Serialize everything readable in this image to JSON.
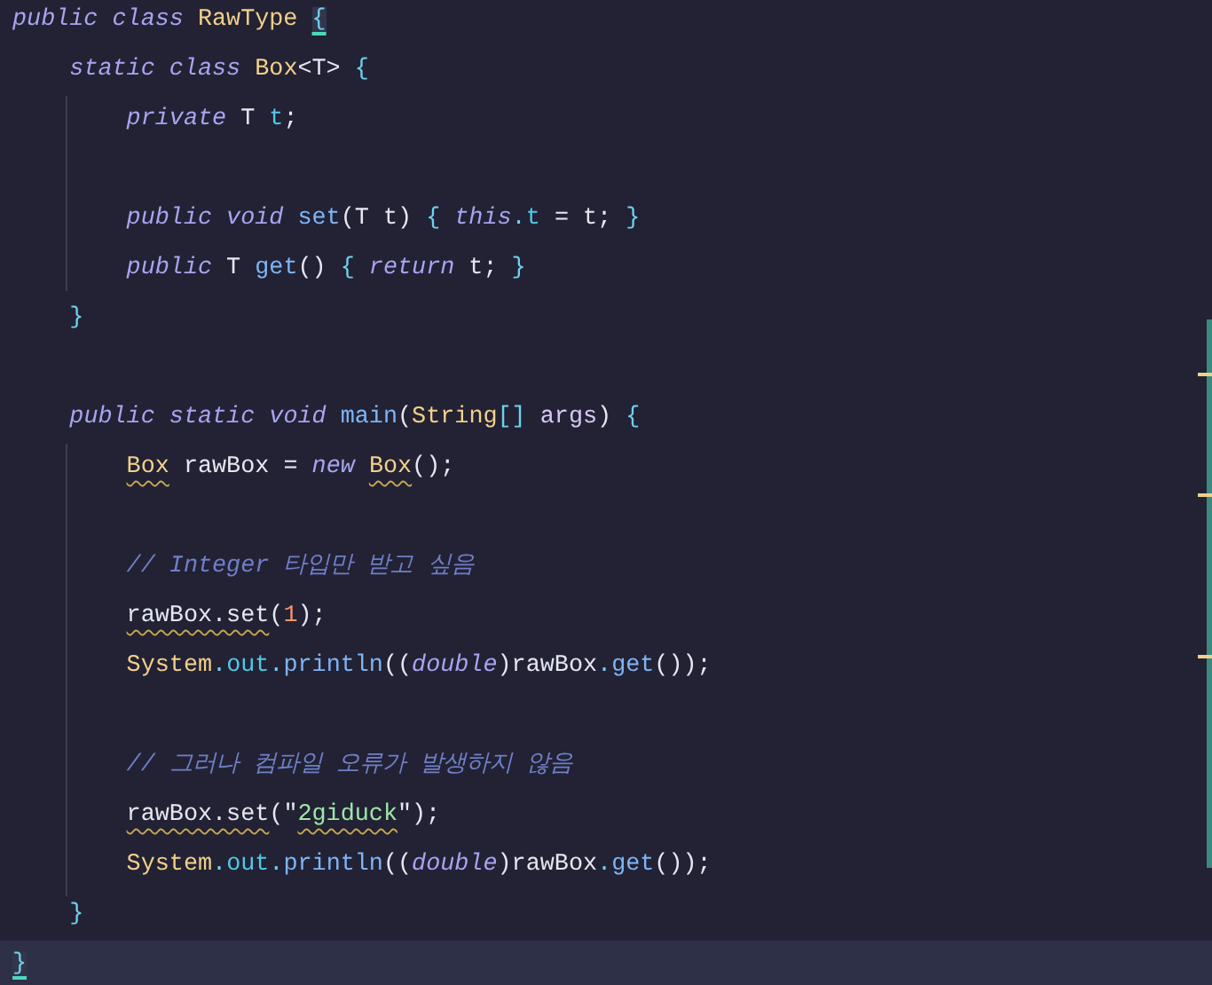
{
  "editor": {
    "lines": [
      {
        "kind": "code",
        "current": false,
        "tokens": [
          {
            "t": "public class ",
            "kind": "keyword"
          },
          {
            "t": "RawType ",
            "kind": "type"
          },
          {
            "t": "{",
            "kind": "brace",
            "matched": true
          }
        ]
      },
      {
        "kind": "code",
        "current": false,
        "tokens": [
          {
            "t": "    static class ",
            "kind": "keyword"
          },
          {
            "t": "Box",
            "kind": "type"
          },
          {
            "t": "<T> ",
            "kind": "plain"
          },
          {
            "t": "{",
            "kind": "brace"
          }
        ]
      },
      {
        "kind": "code",
        "current": false,
        "tokens": [
          {
            "t": "        private ",
            "kind": "keyword"
          },
          {
            "t": "T ",
            "kind": "plain"
          },
          {
            "t": "t",
            "kind": "field"
          },
          {
            "t": ";",
            "kind": "plain"
          }
        ]
      },
      {
        "kind": "blank",
        "current": false
      },
      {
        "kind": "code",
        "current": false,
        "tokens": [
          {
            "t": "        public void ",
            "kind": "keyword"
          },
          {
            "t": "set",
            "kind": "method"
          },
          {
            "t": "(T t) ",
            "kind": "plain"
          },
          {
            "t": "{ ",
            "kind": "brace"
          },
          {
            "t": "this",
            "kind": "keyword"
          },
          {
            "t": ".",
            "kind": "punct"
          },
          {
            "t": "t",
            "kind": "field"
          },
          {
            "t": " = t; ",
            "kind": "plain"
          },
          {
            "t": "}",
            "kind": "brace"
          }
        ]
      },
      {
        "kind": "code",
        "current": false,
        "tokens": [
          {
            "t": "        public ",
            "kind": "keyword"
          },
          {
            "t": "T ",
            "kind": "plain"
          },
          {
            "t": "get",
            "kind": "method"
          },
          {
            "t": "() ",
            "kind": "plain"
          },
          {
            "t": "{ ",
            "kind": "brace"
          },
          {
            "t": "return ",
            "kind": "keyword"
          },
          {
            "t": "t; ",
            "kind": "plain"
          },
          {
            "t": "}",
            "kind": "brace"
          }
        ]
      },
      {
        "kind": "code",
        "current": false,
        "tokens": [
          {
            "t": "    }",
            "kind": "brace"
          }
        ]
      },
      {
        "kind": "blank",
        "current": false
      },
      {
        "kind": "code",
        "current": false,
        "tokens": [
          {
            "t": "    public static void ",
            "kind": "keyword"
          },
          {
            "t": "main",
            "kind": "method"
          },
          {
            "t": "(",
            "kind": "plain"
          },
          {
            "t": "String",
            "kind": "type"
          },
          {
            "t": "[] ",
            "kind": "punct"
          },
          {
            "t": "args",
            "kind": "param"
          },
          {
            "t": ") ",
            "kind": "plain"
          },
          {
            "t": "{",
            "kind": "brace"
          }
        ]
      },
      {
        "kind": "code",
        "current": false,
        "tokens": [
          {
            "t": "        Box",
            "kind": "type",
            "warning": true
          },
          {
            "t": " rawBox = ",
            "kind": "plain"
          },
          {
            "t": "new ",
            "kind": "keyword"
          },
          {
            "t": "Box",
            "kind": "type",
            "warning": true
          },
          {
            "t": "();",
            "kind": "plain"
          }
        ]
      },
      {
        "kind": "blank",
        "current": false
      },
      {
        "kind": "code",
        "current": false,
        "tokens": [
          {
            "t": "        // Integer 타입만 받고 싶음",
            "kind": "comment"
          }
        ]
      },
      {
        "kind": "code",
        "current": false,
        "tokens": [
          {
            "t": "        rawBox.set",
            "kind": "plain",
            "warning": true
          },
          {
            "t": "(",
            "kind": "plain"
          },
          {
            "t": "1",
            "kind": "number"
          },
          {
            "t": ");",
            "kind": "plain"
          }
        ]
      },
      {
        "kind": "code",
        "current": false,
        "tokens": [
          {
            "t": "        System",
            "kind": "type"
          },
          {
            "t": ".",
            "kind": "punct"
          },
          {
            "t": "out",
            "kind": "field"
          },
          {
            "t": ".",
            "kind": "punct"
          },
          {
            "t": "println",
            "kind": "method"
          },
          {
            "t": "((",
            "kind": "plain"
          },
          {
            "t": "double",
            "kind": "keyword"
          },
          {
            "t": ")rawBox",
            "kind": "plain"
          },
          {
            "t": ".",
            "kind": "punct"
          },
          {
            "t": "get",
            "kind": "method"
          },
          {
            "t": "());",
            "kind": "plain"
          }
        ]
      },
      {
        "kind": "blank",
        "current": false
      },
      {
        "kind": "code",
        "current": false,
        "tokens": [
          {
            "t": "        // 그러나 컴파일 오류가 발생하지 않음",
            "kind": "comment"
          }
        ]
      },
      {
        "kind": "code",
        "current": false,
        "tokens": [
          {
            "t": "        rawBox.set",
            "kind": "plain",
            "warning": true
          },
          {
            "t": "(\"",
            "kind": "plain"
          },
          {
            "t": "2giduck",
            "kind": "string",
            "warning": true
          },
          {
            "t": "\");",
            "kind": "plain"
          }
        ]
      },
      {
        "kind": "code",
        "current": false,
        "tokens": [
          {
            "t": "        System",
            "kind": "type"
          },
          {
            "t": ".",
            "kind": "punct"
          },
          {
            "t": "out",
            "kind": "field"
          },
          {
            "t": ".",
            "kind": "punct"
          },
          {
            "t": "println",
            "kind": "method"
          },
          {
            "t": "((",
            "kind": "plain"
          },
          {
            "t": "double",
            "kind": "keyword"
          },
          {
            "t": ")rawBox",
            "kind": "plain"
          },
          {
            "t": ".",
            "kind": "punct"
          },
          {
            "t": "get",
            "kind": "method"
          },
          {
            "t": "());",
            "kind": "plain"
          }
        ]
      },
      {
        "kind": "code",
        "current": false,
        "tokens": [
          {
            "t": "    }",
            "kind": "brace"
          }
        ]
      },
      {
        "kind": "code",
        "current": true,
        "tokens": [
          {
            "t": "}",
            "kind": "brace",
            "matched": true
          }
        ]
      }
    ]
  }
}
